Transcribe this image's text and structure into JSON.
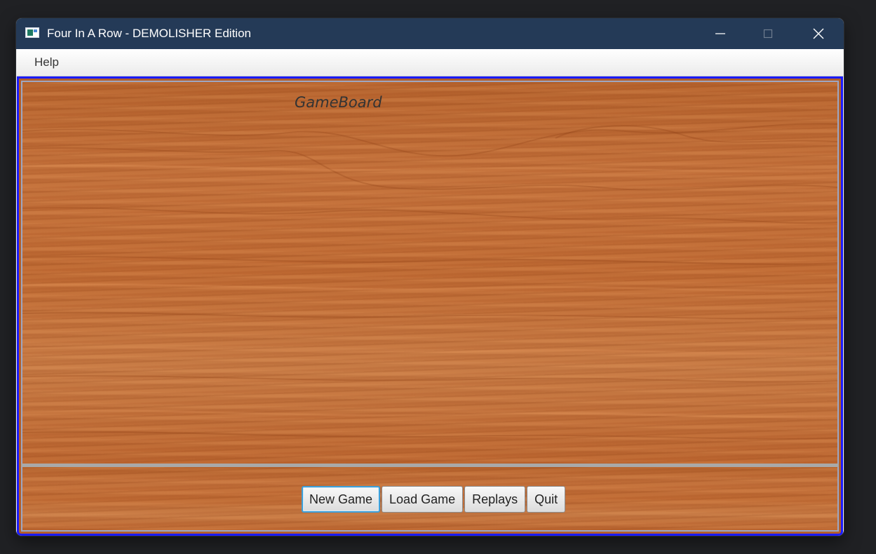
{
  "window": {
    "title": "Four In A Row - DEMOLISHER Edition",
    "app_icon": "app-window-icon",
    "controls": [
      "minimize-icon",
      "maximize-icon",
      "close-icon"
    ]
  },
  "menubar": {
    "items": [
      {
        "label": "Help"
      }
    ]
  },
  "board": {
    "label": "GameBoard"
  },
  "controls": {
    "buttons": [
      {
        "label": "New Game",
        "focused": true
      },
      {
        "label": "Load Game",
        "focused": false
      },
      {
        "label": "Replays",
        "focused": false
      },
      {
        "label": "Quit",
        "focused": false
      }
    ]
  },
  "colors": {
    "titlebar": "#243a57",
    "content_border": "#1a1aff",
    "wood": "#c06a33",
    "focus_ring": "#3e9fd8"
  }
}
